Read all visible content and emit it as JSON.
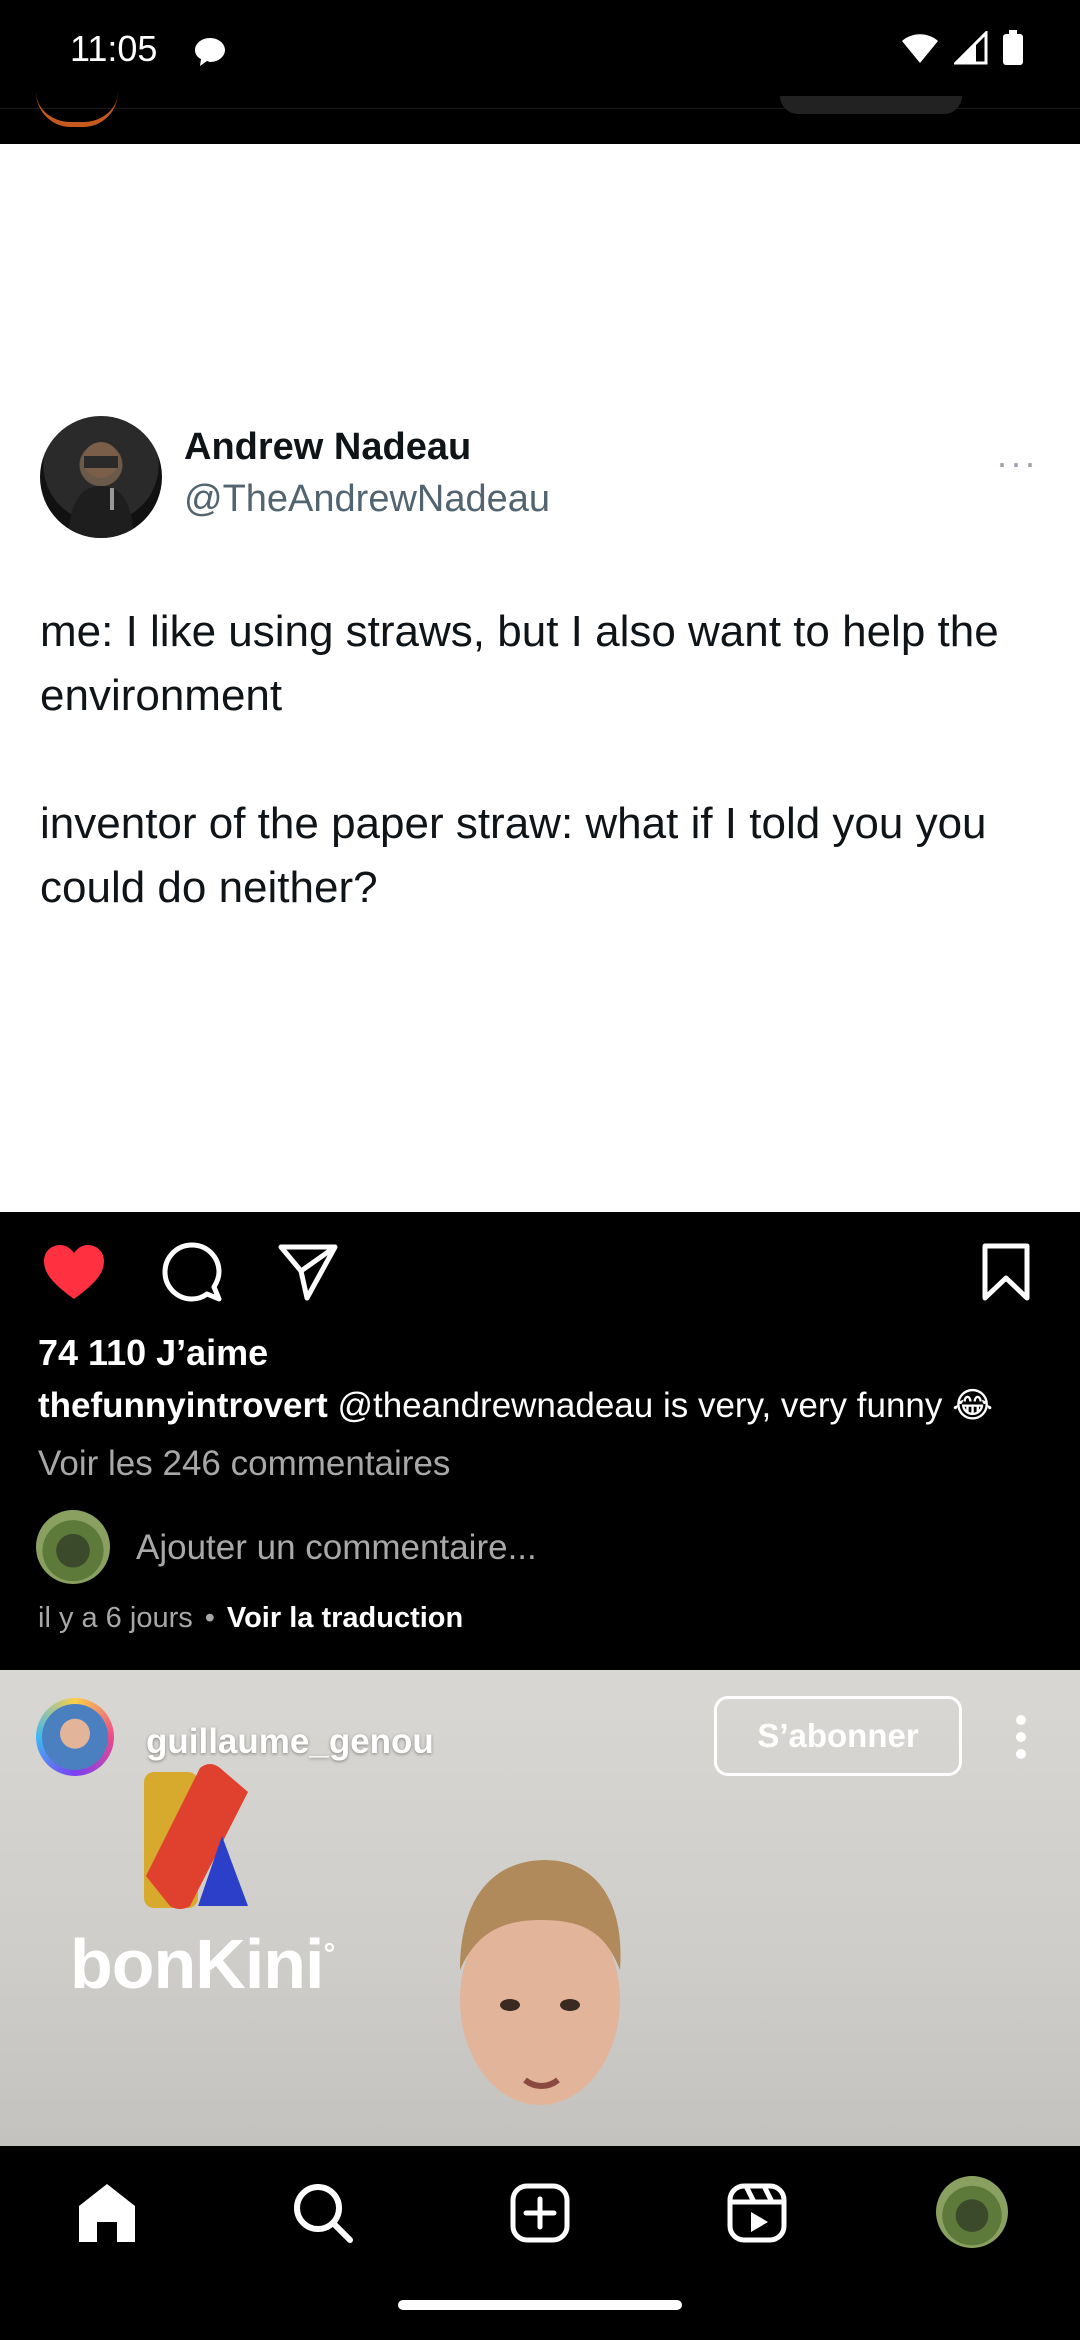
{
  "status_bar": {
    "time": "11:05"
  },
  "tweet": {
    "name": "Andrew Nadeau",
    "handle": "@TheAndrewNadeau",
    "more": "···",
    "text": "me: I like using straws, but I also want to help the environment\n\ninventor of the paper straw: what if I told you you could do neither?"
  },
  "post": {
    "likes": "74 110 J’aime",
    "caption_user": "thefunnyintrovert",
    "caption_text": " @theandrewnadeau is very, very funny 😂",
    "view_comments": "Voir les 246 commentaires",
    "comment_placeholder": "Ajouter un commentaire...",
    "time_ago": "il y a 6 jours",
    "dot": "•",
    "translate": "Voir la traduction",
    "like_color": "#ff3040"
  },
  "next_reel": {
    "username": "guillaume_genou",
    "follow_label": "S’abonner",
    "logo_text": "bonKini",
    "logo_superscript": "°"
  },
  "nav": {
    "items": [
      "home-icon",
      "search-icon",
      "create-icon",
      "reels-icon",
      "profile-icon"
    ]
  }
}
